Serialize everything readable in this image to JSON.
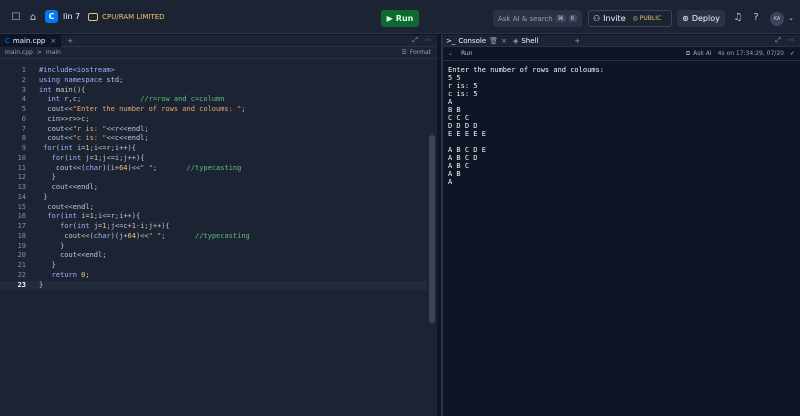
{
  "topbar": {
    "repl_name": "lin 7",
    "plan_label": "CPU/RAM LIMITED",
    "run_label": "Run",
    "search_label": "Ask AI & search",
    "search_kbd_1": "⌘",
    "search_kbd_2": "K",
    "invite_label": "Invite",
    "public_label": "PUBLIC",
    "deploy_label": "Deploy",
    "help_label": "?",
    "avatar_initials": "KA"
  },
  "editor": {
    "tab_label": "main.cpp",
    "breadcrumb_file": "main.cpp",
    "breadcrumb_sep": ">",
    "breadcrumb_symbol": "main",
    "format_label": "Format",
    "current_line": 23
  },
  "console": {
    "tab_console": "Console",
    "tab_shell": "Shell",
    "run_label": "Run",
    "ask_ai": "Ask AI",
    "run_time": "4s on 17:34:29, 07/20",
    "output": "Enter the number of rows and coloums:\n5 5\nr is: 5\nc is: 5\nA\nB B\nC C C\nD D D D\nE E E E E\n\nA B C D E\nA B C D\nA B C\nA B\nA"
  },
  "colors": {
    "run_button": "#0b6a2f",
    "accent": "#0079f2",
    "plan": "#e9c46a"
  }
}
